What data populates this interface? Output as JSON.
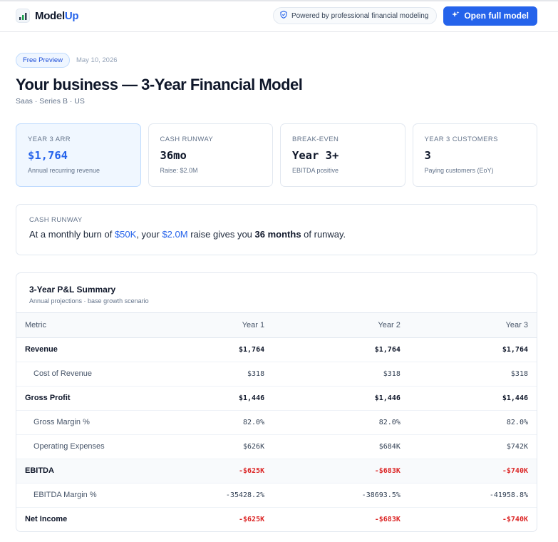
{
  "brand": {
    "name_prefix": "Model",
    "name_suffix": "Up"
  },
  "header": {
    "powered_text": "Powered by professional financial modeling",
    "open_button": "Open full model"
  },
  "meta": {
    "badge": "Free Preview",
    "date": "May 10, 2026"
  },
  "title": "Your business — 3-Year Financial Model",
  "subtitle": "Saas · Series B · US",
  "kpis": [
    {
      "label": "YEAR 3 ARR",
      "value": "$1,764",
      "sub": "Annual recurring revenue"
    },
    {
      "label": "CASH RUNWAY",
      "value": "36mo",
      "sub": "Raise: $2.0M"
    },
    {
      "label": "BREAK-EVEN",
      "value": "Year 3+",
      "sub": "EBITDA positive"
    },
    {
      "label": "YEAR 3 CUSTOMERS",
      "value": "3",
      "sub": "Paying customers (EoY)"
    }
  ],
  "runway": {
    "label": "CASH RUNWAY",
    "t1": "At a monthly burn of ",
    "burn": "$50K",
    "t2": ", your ",
    "raise": "$2.0M",
    "t3": " raise gives you ",
    "months": "36 months",
    "t4": " of runway."
  },
  "pl": {
    "title": "3-Year P&L Summary",
    "subtitle": "Annual projections · base growth scenario",
    "columns": [
      "Metric",
      "Year 1",
      "Year 2",
      "Year 3"
    ],
    "rows": [
      {
        "metric": "Revenue",
        "y1": "$1,764",
        "y2": "$1,764",
        "y3": "$1,764"
      },
      {
        "metric": "Cost of Revenue",
        "y1": "$318",
        "y2": "$318",
        "y3": "$318"
      },
      {
        "metric": "Gross Profit",
        "y1": "$1,446",
        "y2": "$1,446",
        "y3": "$1,446"
      },
      {
        "metric": "Gross Margin %",
        "y1": "82.0%",
        "y2": "82.0%",
        "y3": "82.0%"
      },
      {
        "metric": "Operating Expenses",
        "y1": "$626K",
        "y2": "$684K",
        "y3": "$742K"
      },
      {
        "metric": "EBITDA",
        "y1": "-$625K",
        "y2": "-$683K",
        "y3": "-$740K"
      },
      {
        "metric": "EBITDA Margin %",
        "y1": "-35428.2%",
        "y2": "-38693.5%",
        "y3": "-41958.8%"
      },
      {
        "metric": "Net Income",
        "y1": "-$625K",
        "y2": "-$683K",
        "y3": "-$740K"
      }
    ]
  },
  "colors": {
    "accent": "#2563eb",
    "negative": "#dc2626",
    "text": "#0f172a"
  }
}
